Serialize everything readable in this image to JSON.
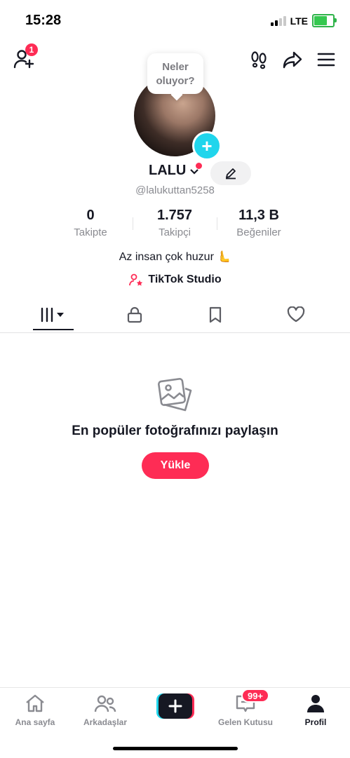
{
  "status_bar": {
    "time": "15:28",
    "network": "LTE"
  },
  "header": {
    "notification_count": "1"
  },
  "tooltip": {
    "text_line1": "Neler",
    "text_line2": "oluyor?"
  },
  "profile": {
    "display_name": "LALU",
    "username": "@lalukuttan5258",
    "bio": "Az insan çok huzur 🫷",
    "studio_label": "TikTok Studio"
  },
  "stats": [
    {
      "value": "0",
      "label": "Takipte"
    },
    {
      "value": "1.757",
      "label": "Takipçi"
    },
    {
      "value": "11,3 B",
      "label": "Beğeniler"
    }
  ],
  "tabs": [
    "grid-filter-icon",
    "lock-icon",
    "bookmark-icon",
    "heart-icon"
  ],
  "empty_state": {
    "title": "En popüler fotoğrafınızı paylaşın",
    "button_label": "Yükle"
  },
  "bottom_nav": {
    "items": [
      {
        "label": "Ana sayfa",
        "icon": "home-icon"
      },
      {
        "label": "Arkadaşlar",
        "icon": "friends-icon"
      },
      {
        "label": "Gelen Kutusu",
        "icon": "inbox-icon"
      },
      {
        "label": "Profil",
        "icon": "profile-icon"
      }
    ],
    "inbox_badge": "99+"
  },
  "colors": {
    "accent": "#fe2c55",
    "cyan": "#20d5ec",
    "text": "#161823",
    "muted": "#8a8b91"
  }
}
